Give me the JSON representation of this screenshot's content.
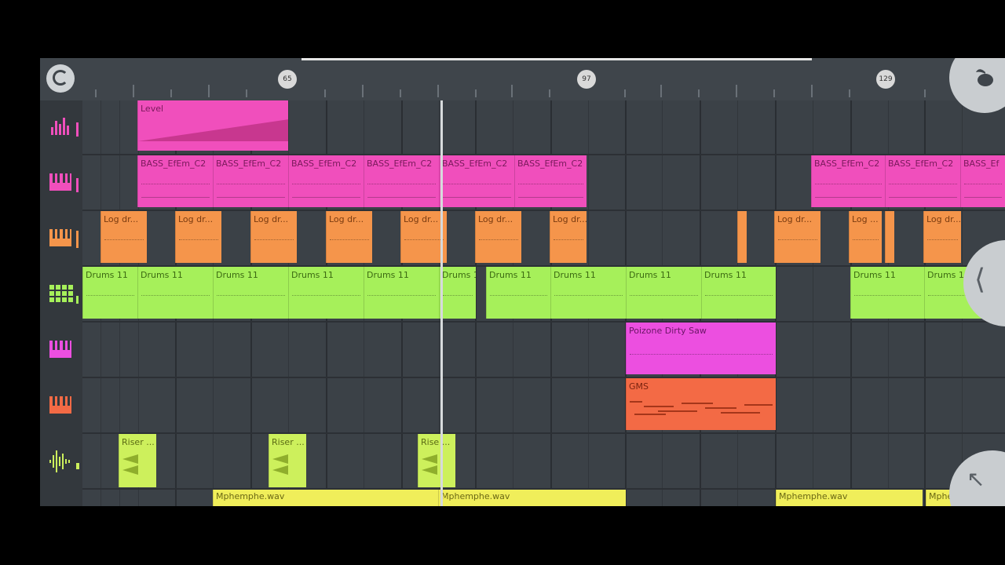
{
  "ruler": {
    "bar_markers": [
      "65",
      "97",
      "129"
    ]
  },
  "tracks": [
    {
      "icon": "automation-icon",
      "color": "#f04fbc"
    },
    {
      "icon": "piano-icon",
      "color": "#f04fbc"
    },
    {
      "icon": "piano-icon",
      "color": "#f5954b"
    },
    {
      "icon": "step-sequencer-icon",
      "color": "#a6f05a"
    },
    {
      "icon": "piano-icon",
      "color": "#ec4fe0"
    },
    {
      "icon": "piano-icon",
      "color": "#f36a45"
    },
    {
      "icon": "waveform-icon",
      "color": "#cdf05c"
    }
  ],
  "clips": {
    "level": "Level",
    "bass": "BASS_EfEm_C2",
    "bass_partial": "BASS_Ef",
    "log": "Log dr...",
    "log_short": "Log ...",
    "drums": "Drums 11",
    "saw": "Poizone Dirty Saw",
    "gms": "GMS",
    "riser": "Riser ...",
    "riser_short": "Rise ...",
    "mphemphe": "Mphemphe.wav",
    "mphemphe_partial": "Mphemphe.wa"
  },
  "buttons": {
    "collapse": "⟨",
    "expand": "↖"
  }
}
